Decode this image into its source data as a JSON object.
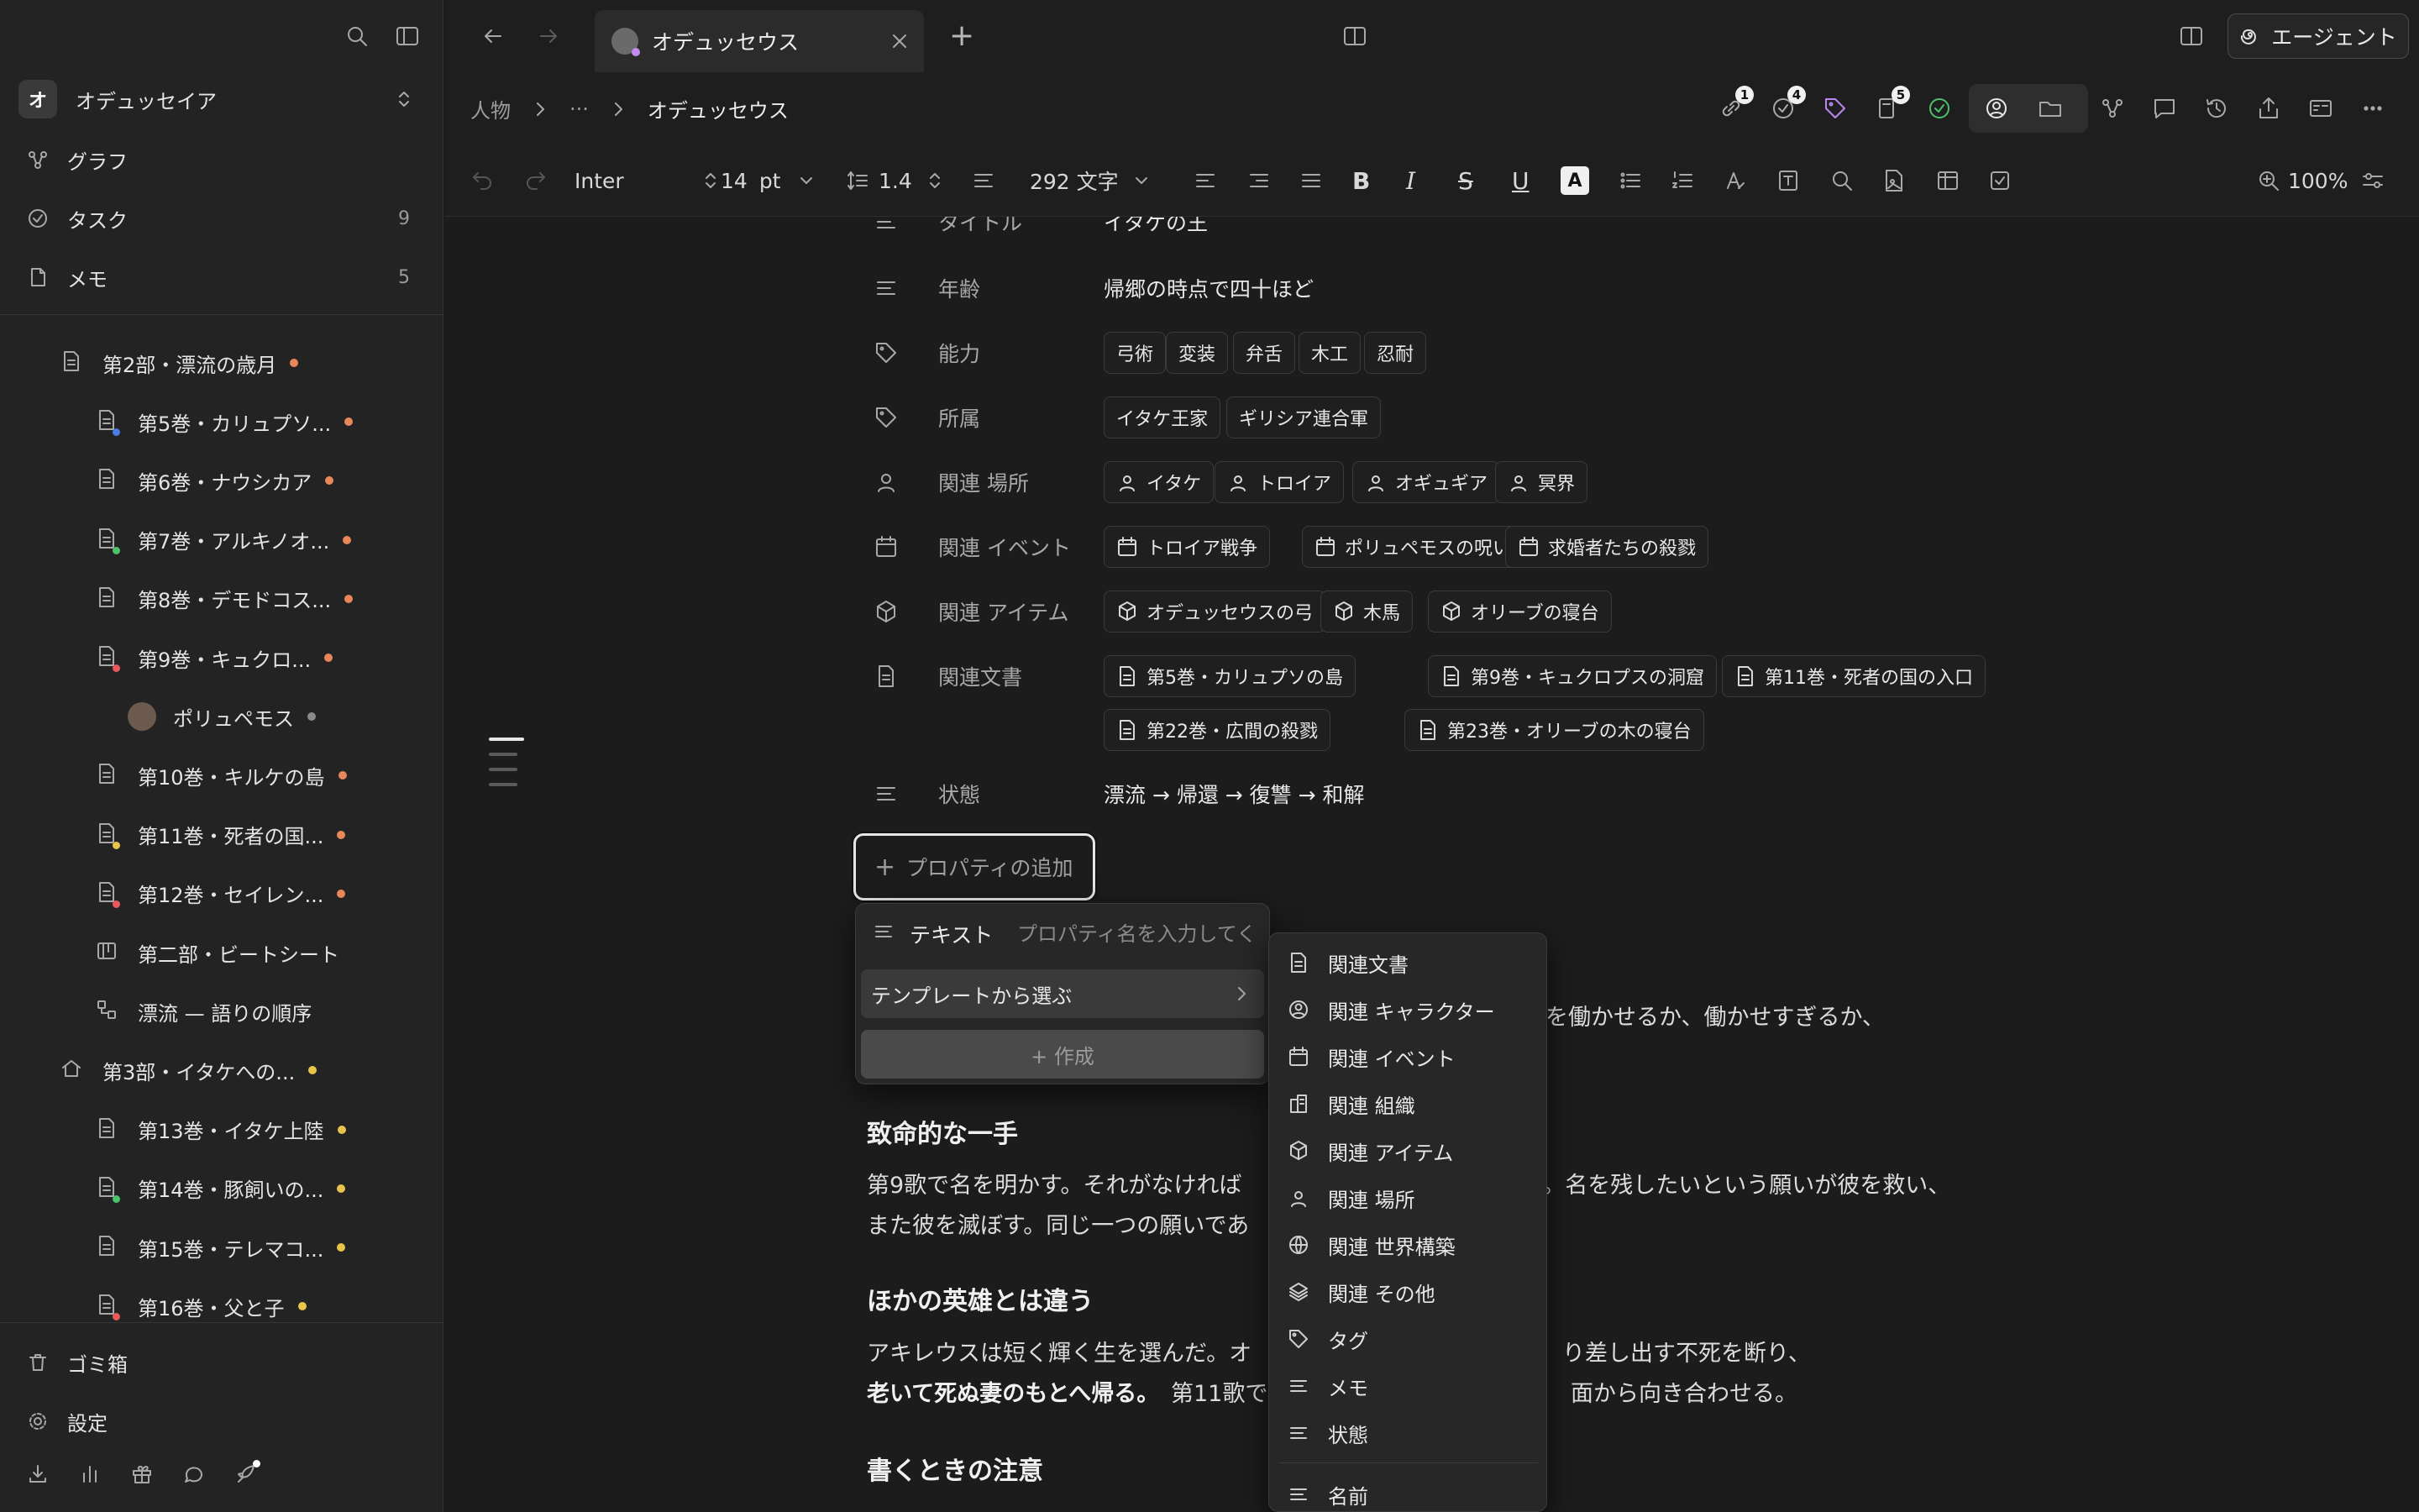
{
  "sidebar": {
    "workspace": {
      "initial": "オ",
      "name": "オデュッセイア"
    },
    "nav": [
      {
        "label": "グラフ",
        "count": ""
      },
      {
        "label": "タスク",
        "count": "9"
      },
      {
        "label": "メモ",
        "count": "5"
      }
    ],
    "tree": [
      {
        "label": "第2部・漂流の歳月",
        "dot": "#e8885a",
        "mini": ""
      },
      {
        "label": "第5巻・カリュプソ...",
        "dot": "#e8885a",
        "mini": "#4a7de8"
      },
      {
        "label": "第6巻・ナウシカア",
        "dot": "#e8885a",
        "mini": ""
      },
      {
        "label": "第7巻・アルキノオ...",
        "dot": "#e8885a",
        "mini": "#4cc26a"
      },
      {
        "label": "第8巻・デモドコス...",
        "dot": "#e8885a",
        "mini": ""
      },
      {
        "label": "第9巻・キュクロ...",
        "dot": "#e8885a",
        "mini": "#e85a5a"
      },
      {
        "label": "ポリュペモス",
        "dot": "#8a8a8a",
        "mini": ""
      },
      {
        "label": "第10巻・キルケの島",
        "dot": "#e8885a",
        "mini": ""
      },
      {
        "label": "第11巻・死者の国...",
        "dot": "#e8885a",
        "mini": "#e8c44a"
      },
      {
        "label": "第12巻・セイレン...",
        "dot": "#e8885a",
        "mini": "#e85a5a"
      },
      {
        "label": "第二部・ビートシート",
        "dot": "",
        "mini": ""
      },
      {
        "label": "漂流 — 語りの順序",
        "dot": "",
        "mini": ""
      },
      {
        "label": "第3部・イタケへの...",
        "dot": "#e8c44a",
        "mini": ""
      },
      {
        "label": "第13巻・イタケ上陸",
        "dot": "#e8c44a",
        "mini": ""
      },
      {
        "label": "第14巻・豚飼いの...",
        "dot": "#e8c44a",
        "mini": "#4cc26a"
      },
      {
        "label": "第15巻・テレマコ...",
        "dot": "#e8c44a",
        "mini": ""
      },
      {
        "label": "第16巻・父と子",
        "dot": "#e8c44a",
        "mini": "#e85a5a"
      }
    ],
    "bottom": [
      {
        "label": "ゴミ箱"
      },
      {
        "label": "設定"
      }
    ]
  },
  "tab": {
    "title": "オデュッセウス",
    "new_tab": "+"
  },
  "agent_label": "エージェント",
  "breadcrumb": {
    "root": "人物",
    "ellipsis": "···",
    "current": "オデュッセウス"
  },
  "badges": {
    "links": "1",
    "tasks": "4",
    "docs": "5"
  },
  "toolbar": {
    "font": "Inter",
    "size": "14",
    "size_unit": "pt",
    "line_height": "1.4",
    "word_count": "292 文字",
    "zoom": "100%"
  },
  "properties": {
    "title": {
      "label": "タイトル",
      "value": "イタケの王"
    },
    "age": {
      "label": "年齢",
      "value": "帰郷の時点で四十ほど"
    },
    "abilities": {
      "label": "能力",
      "chips": [
        "弓術",
        "変装",
        "弁舌",
        "木工",
        "忍耐"
      ]
    },
    "affiliation": {
      "label": "所属",
      "chips": [
        "イタケ王家",
        "ギリシア連合軍"
      ]
    },
    "places": {
      "label": "関連 場所",
      "chips": [
        "イタケ",
        "トロイア",
        "オギュギア",
        "冥界"
      ]
    },
    "events": {
      "label": "関連 イベント",
      "chips": [
        "トロイア戦争",
        "ポリュペモスの呪い",
        "求婚者たちの殺戮"
      ]
    },
    "items": {
      "label": "関連 アイテム",
      "chips": [
        "オデュッセウスの弓",
        "木馬",
        "オリーブの寝台"
      ]
    },
    "documents": {
      "label": "関連文書",
      "chips": [
        "第5巻・カリュプソの島",
        "第9巻・キュクロプスの洞窟",
        "第11巻・死者の国の入口",
        "第22巻・広間の殺戮",
        "第23巻・オリーブの木の寝台"
      ]
    },
    "state": {
      "label": "状態",
      "value": "漂流 → 帰還 → 復讐 → 和解"
    }
  },
  "add_property": "プロパティの追加",
  "menu1": {
    "type_label": "テキスト",
    "name_placeholder": "プロパティ名を入力してく",
    "template": "テンプレートから選ぶ",
    "create": "+ 作成"
  },
  "menu2": {
    "items": [
      "関連文書",
      "関連 キャラクター",
      "関連 イベント",
      "関連 組織",
      "関連 アイテム",
      "関連 場所",
      "関連 世界構築",
      "関連 その他",
      "タグ",
      "メモ",
      "状態",
      "名前"
    ]
  },
  "body": {
    "fragment1": "を働かせるか、働かせすぎるか、",
    "h1": "致命的な一手",
    "p1a": "第9歌で名を明かす。それがなければ",
    "p1a_tail": "だ。名を残したいという願いが彼を救い、",
    "p1b": "また彼を滅ぼす。同じ一つの願いであ",
    "h2": "ほかの英雄とは違う",
    "p2a": "アキレウスは短く輝く生を選んだ。オ",
    "p2a_tail": "り差し出す不死を断り、",
    "p2b_bold": "老いて死ぬ妻のもとへ帰る。",
    "p2b": "第11歌で",
    "p2b_tail": "面から向き合わせる。",
    "h3": "書くときの注意"
  }
}
